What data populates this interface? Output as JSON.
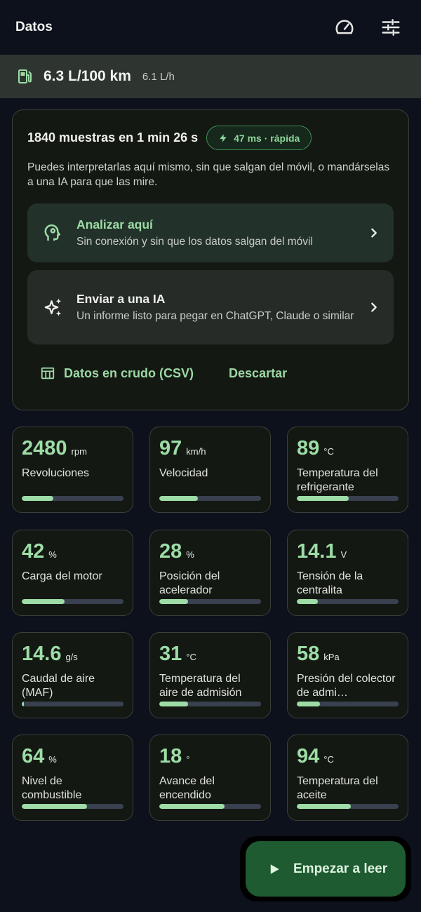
{
  "app": {
    "title": "Datos",
    "icons": [
      "speedometer-icon",
      "sliders-icon"
    ]
  },
  "fuel": {
    "main": "6.3 L/100 km",
    "sub": "6.1 L/h",
    "icon": "fuel-pump-icon"
  },
  "summary": {
    "count": "1840 muestras en 1 min 26 s",
    "badge": "47 ms · rápida",
    "description": "Puedes interpretarlas aquí mismo, sin que salgan del móvil, o mandárselas a una IA para que las mire.",
    "analyze": {
      "title": "Analizar aquí",
      "subtitle": "Sin conexión y sin que los datos salgan del móvil"
    },
    "send_ai": {
      "title": "Enviar a una IA",
      "subtitle": "Un informe listo para pegar en ChatGPT, Claude o similar"
    },
    "raw_data": "Datos en crudo (CSV)",
    "discard": "Descartar"
  },
  "tiles": [
    {
      "value": "2480",
      "unit": "rpm",
      "label": "Revoluciones",
      "level": 0.31
    },
    {
      "value": "97",
      "unit": "km/h",
      "label": "Velocidad",
      "level": 0.38
    },
    {
      "value": "89",
      "unit": "°C",
      "label": "Temperatura del refrigerante",
      "level": 0.51
    },
    {
      "value": "42",
      "unit": "%",
      "label": "Carga del motor",
      "level": 0.42
    },
    {
      "value": "28",
      "unit": "%",
      "label": "Posición del acelerador",
      "level": 0.28
    },
    {
      "value": "14.1",
      "unit": "V",
      "label": "Tensión de la centralita",
      "level": 0.21
    },
    {
      "value": "14.6",
      "unit": "g/s",
      "label": "Caudal de aire (MAF)",
      "level": 0.02
    },
    {
      "value": "31",
      "unit": "°C",
      "label": "Temperatura del aire de admisión",
      "level": 0.28
    },
    {
      "value": "58",
      "unit": "kPa",
      "label": "Presión del colector de admi…",
      "level": 0.23
    },
    {
      "value": "64",
      "unit": "%",
      "label": "Nivel de combustible",
      "level": 0.64
    },
    {
      "value": "18",
      "unit": "°",
      "label": "Avance del encendido",
      "level": 0.64
    },
    {
      "value": "94",
      "unit": "°C",
      "label": "Temperatura del aceite",
      "level": 0.53
    }
  ],
  "fab": {
    "label": "Empezar a leer"
  },
  "colors": {
    "accent": "#9ddca6",
    "background": "#0d111c",
    "fab": "#1f5b31"
  }
}
